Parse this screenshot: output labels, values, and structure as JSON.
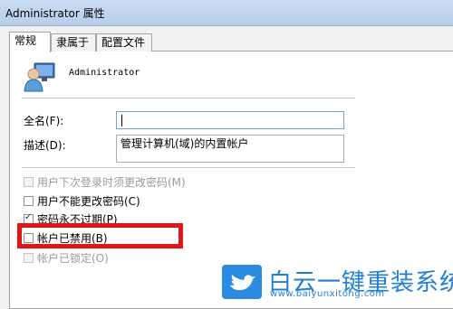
{
  "window": {
    "title": "Administrator 属性"
  },
  "tabs": [
    {
      "label": "常规"
    },
    {
      "label": "隶属于"
    },
    {
      "label": "配置文件"
    }
  ],
  "user": {
    "name": "Administrator"
  },
  "fields": {
    "full_name": {
      "label": "全名(F):",
      "value": ""
    },
    "description": {
      "label": "描述(D):",
      "value": "管理计算机(域)的内置帐户"
    }
  },
  "checkboxes": [
    {
      "label": "用户下次登录时须更改密码(M)",
      "checked": false,
      "disabled": true
    },
    {
      "label": "用户不能更改密码(C)",
      "checked": false,
      "disabled": false
    },
    {
      "label": "密码永不过期(P)",
      "checked": true,
      "disabled": false
    },
    {
      "label": "帐户已禁用(B)",
      "checked": false,
      "disabled": false
    },
    {
      "label": "帐户已锁定(O)",
      "checked": false,
      "disabled": true
    }
  ],
  "watermark": {
    "text": "白云一键重装系统",
    "url": "www.baiyunxitong.com",
    "color": "#1f7fd6"
  },
  "colors": {
    "highlight": "#e21616"
  }
}
